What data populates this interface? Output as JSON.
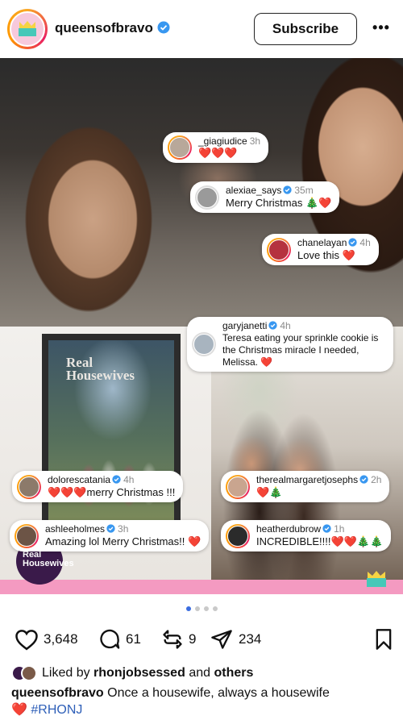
{
  "header": {
    "username": "queensofbravo",
    "subscribe_label": "Subscribe",
    "more_label": "•••"
  },
  "poster": {
    "title_line1": "Real",
    "title_line2": "Housewives"
  },
  "logo_badge": {
    "line1": "Real",
    "line2": "Housewives"
  },
  "comments": [
    {
      "user": "_giagiudice",
      "time": "3h",
      "verified": false,
      "text": "❤️❤️❤️"
    },
    {
      "user": "alexiae_says",
      "time": "35m",
      "verified": true,
      "text": "Merry Christmas 🎄❤️"
    },
    {
      "user": "chanelayan",
      "time": "4h",
      "verified": true,
      "text": "Love this ❤️"
    },
    {
      "user": "garyjanetti",
      "time": "4h",
      "verified": true,
      "text": "Teresa eating your sprinkle cookie is the Christmas miracle I needed, Melissa. ❤️"
    },
    {
      "user": "dolorescatania",
      "time": "4h",
      "verified": true,
      "text": "❤️❤️❤️merry Christmas !!!"
    },
    {
      "user": "therealmargaretjosephs",
      "time": "2h",
      "verified": true,
      "text": "❤️🎄"
    },
    {
      "user": "ashleeholmes",
      "time": "3h",
      "verified": true,
      "text": "Amazing lol Merry Christmas!! ❤️"
    },
    {
      "user": "heatherdubrow",
      "time": "1h",
      "verified": true,
      "text": "INCREDIBLE!!!!❤️❤️🎄🎄"
    }
  ],
  "pagination": {
    "total": 4,
    "active": 0
  },
  "actions": {
    "likes": "3,648",
    "comments": "61",
    "reposts": "9",
    "shares": "234"
  },
  "liked_by": {
    "prefix": "Liked by",
    "user": "rhonjobsessed",
    "connector": "and",
    "others": "others"
  },
  "caption": {
    "username": "queensofbravo",
    "text": "Once a housewife, always a housewife",
    "emoji": "❤️",
    "hashtag": "#RHONJ"
  },
  "colors": {
    "accent_blue": "#3b6de0",
    "heart_red": "#e0245e",
    "brand_pink": "#f49ac1",
    "verified_blue": "#3897f0"
  }
}
